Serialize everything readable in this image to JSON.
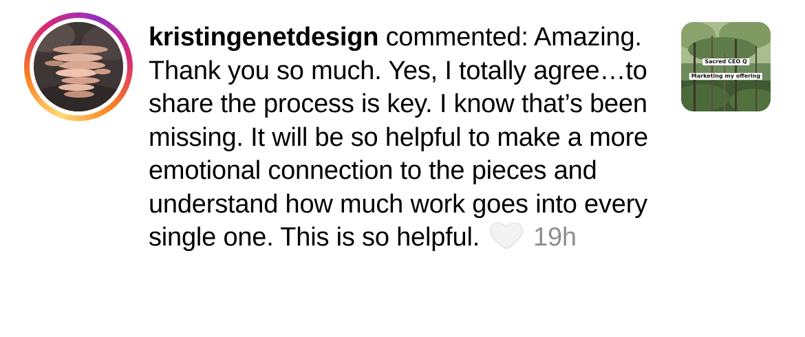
{
  "comment": {
    "username": "kristingenetdesign",
    "action": " commented:",
    "text": " Amazing. Thank you so much. Yes, I totally agree…to share the process is key. I know that’s been missing. It will be so helpful to make a more emotional connection to the pieces and understand how much work goes into every single one. This is so helpful.",
    "timestamp": "19h",
    "like_icon": "heart-outline-icon"
  },
  "post_thumbnail": {
    "label_line1": "Sacred CEO Q",
    "label_line2": "Marketing my offering"
  },
  "colors": {
    "timestamp": "#8e8e8e",
    "story_ring": [
      "#feda75",
      "#fa7e1e",
      "#d62976",
      "#962fbf"
    ]
  }
}
